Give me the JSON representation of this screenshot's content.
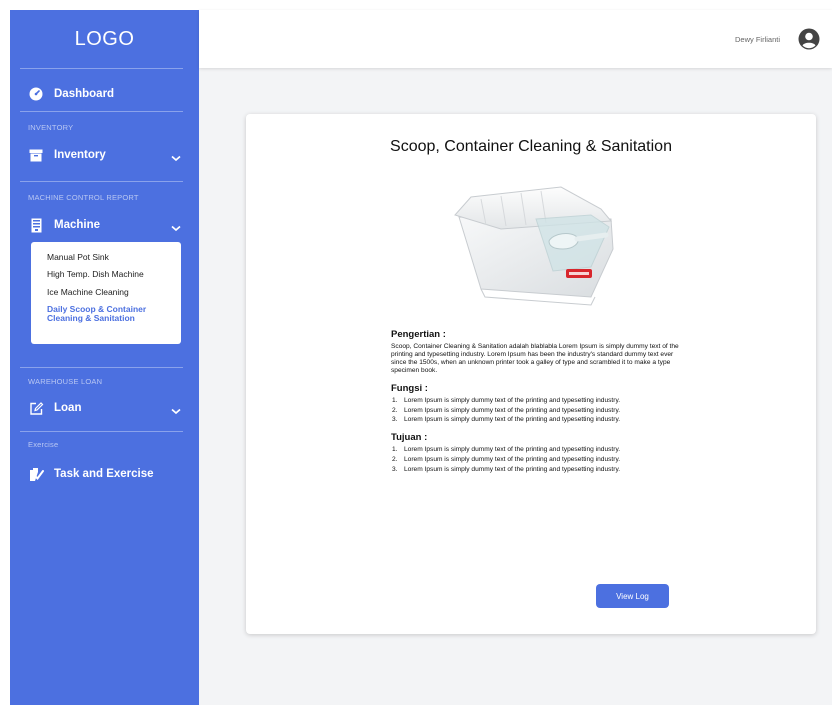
{
  "sidebar": {
    "logo": "LOGO",
    "dashboard": "Dashboard",
    "inventory_section": "INVENTORY",
    "inventory": "Inventory",
    "machine_section": "MACHINE CONTROL REPORT",
    "machine": "Machine",
    "machine_items": [
      "Manual Pot Sink",
      "High Temp. Dish Machine",
      "Ice Machine Cleaning",
      "Daily Scoop & Container Cleaning & Sanitation"
    ],
    "warehouse_section": "WAREHOUSE LOAN",
    "loan": "Loan",
    "exercise_section": "Exercise",
    "task": "Task and Exercise"
  },
  "header": {
    "user_name": "Dewy Firlianti"
  },
  "card": {
    "title": "Scoop, Container Cleaning & Sanitation",
    "pengertian_heading": "Pengertian :",
    "pengertian_text": "Scoop, Container Cleaning & Sanitation adalah blablabla  Lorem Ipsum is simply dummy text of the printing and typesetting industry. Lorem Ipsum has been the industry's standard dummy text ever since the 1500s, when an unknown printer took a galley of type and scrambled it to make a type specimen book.",
    "fungsi_heading": "Fungsi :",
    "fungsi_items": [
      "Lorem Ipsum is simply dummy text of the printing and typesetting industry.",
      "Lorem Ipsum is simply dummy text of the printing and typesetting industry.",
      "Lorem Ipsum is simply dummy text of the printing and typesetting industry."
    ],
    "tujuan_heading": "Tujuan :",
    "tujuan_items": [
      "Lorem Ipsum is simply dummy text of the printing and typesetting industry.",
      "Lorem Ipsum is simply dummy text of the printing and typesetting industry.",
      "Lorem Ipsum is simply dummy text of the printing and typesetting industry."
    ],
    "list_numbers": [
      "1.",
      "2.",
      "3."
    ],
    "view_log": "View Log"
  },
  "colors": {
    "sidebar_bg": "#4c70e0",
    "accent": "#4c70e0",
    "page_bg": "#f3f4f6"
  },
  "icons": {
    "dashboard": "speedometer-icon",
    "inventory": "archive-box-icon",
    "machine": "machine-icon",
    "loan": "edit-icon",
    "task": "task-icon",
    "user": "user-avatar-icon",
    "chevron": "chevron-down-icon"
  }
}
